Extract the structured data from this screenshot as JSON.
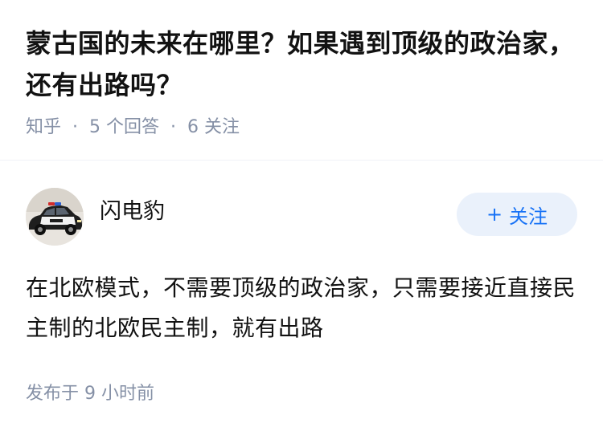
{
  "question": {
    "title": "蒙古国的未来在哪里？如果遇到顶级的政治家，还有出路吗？",
    "source": "知乎",
    "answer_count": "5 个回答",
    "follower_count": "6 关注",
    "separator": "·"
  },
  "answer": {
    "author_name": "闪电豹",
    "follow_label": "关注",
    "follow_icon": "+",
    "content": "在北欧模式，不需要顶级的政治家，只需要接近直接民主制的北欧民主制，就有出路",
    "published": "发布于  9 小时前"
  },
  "colors": {
    "accent": "#1772f6",
    "meta": "#8590a6"
  }
}
